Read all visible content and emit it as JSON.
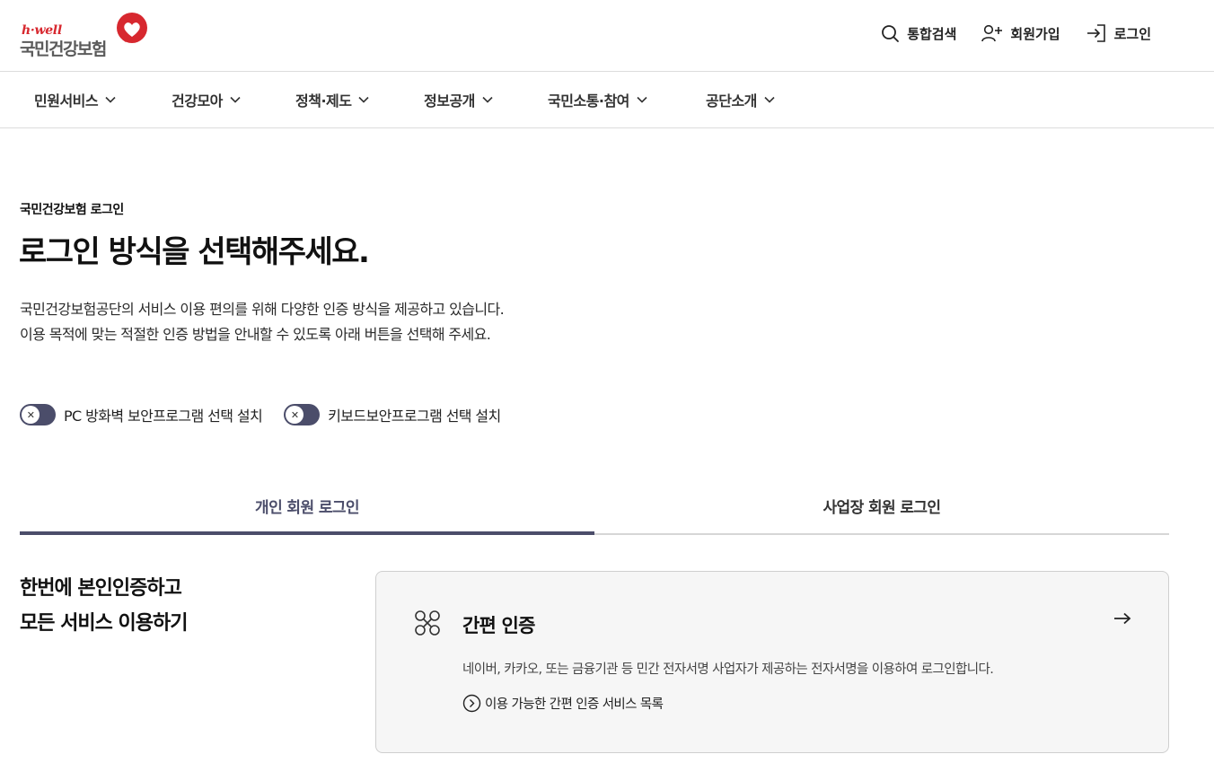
{
  "brand": {
    "sub_logo": "h·well",
    "name": "국민건강보험",
    "accent_color": "#d7282f",
    "primary_color": "#4b4d6a"
  },
  "util_nav": [
    {
      "label": "통합검색",
      "icon": "search-icon"
    },
    {
      "label": "회원가입",
      "icon": "user-plus-icon"
    },
    {
      "label": "로그인",
      "icon": "login-icon"
    }
  ],
  "gnb": [
    {
      "label": "민원서비스"
    },
    {
      "label": "건강모아"
    },
    {
      "label": "정책·제도"
    },
    {
      "label": "정보공개"
    },
    {
      "label": "국민소통·참여"
    },
    {
      "label": "공단소개"
    }
  ],
  "page": {
    "breadcrumb": "국민건강보험 로그인",
    "title": "로그인 방식을 선택해주세요.",
    "desc_line1": "국민건강보험공단의 서비스 이용 편의를 위해 다양한 인증 방식을 제공하고 있습니다.",
    "desc_line2": "이용 목적에 맞는 적절한 인증 방법을 안내할 수 있도록 아래 버튼을 선택해 주세요."
  },
  "toggles": [
    {
      "label": "PC 방화벽 보안프로그램 선택 설치",
      "state": "off"
    },
    {
      "label": "키보드보안프로그램 선택 설치",
      "state": "off"
    }
  ],
  "tabs": [
    {
      "label": "개인 회원 로그인",
      "active": true
    },
    {
      "label": "사업장 회원 로그인",
      "active": false
    }
  ],
  "side_heading": {
    "line1": "한번에 본인인증하고",
    "line2": "모든 서비스 이용하기"
  },
  "card": {
    "title": "간편 인증",
    "description": "네이버, 카카오, 또는 금융기관 등 민간 전자서명 사업자가 제공하는 전자서명을 이용하여 로그인합니다.",
    "link_label": "이용 가능한 간편 인증 서비스 목록",
    "icon": "simple-auth-icon"
  }
}
